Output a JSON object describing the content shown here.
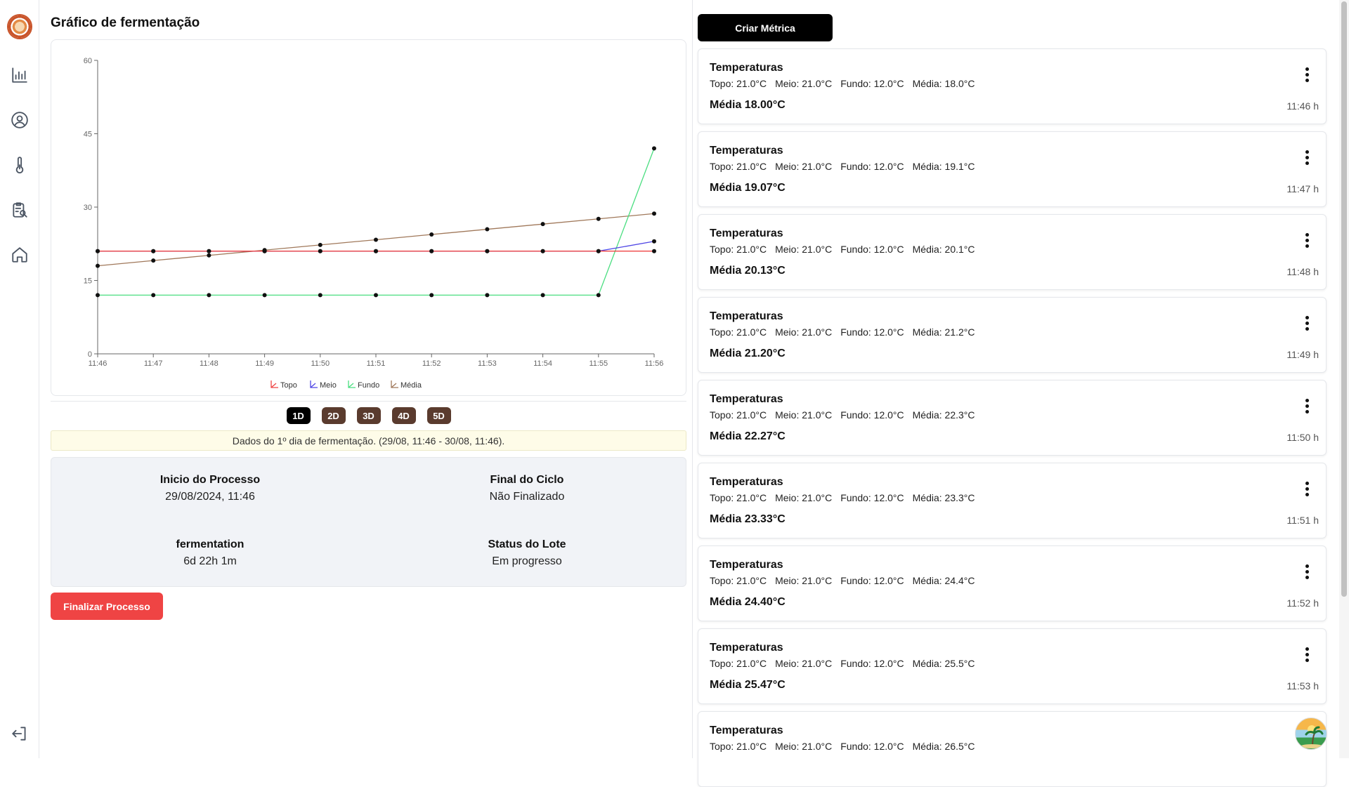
{
  "app": {
    "page_title": "Gráfico de fermentação"
  },
  "sidebar": {
    "items": [
      {
        "icon": "bar-chart-icon"
      },
      {
        "icon": "user-circle-icon"
      },
      {
        "icon": "thermometer-icon"
      },
      {
        "icon": "clipboard-search-icon"
      },
      {
        "icon": "home-icon"
      }
    ],
    "logout_icon": "logout-icon"
  },
  "chart_data": {
    "type": "line",
    "x": [
      "11:46",
      "11:47",
      "11:48",
      "11:49",
      "11:50",
      "11:51",
      "11:52",
      "11:53",
      "11:54",
      "11:55",
      "11:56"
    ],
    "yticks": [
      "0",
      "15",
      "30",
      "45",
      "60"
    ],
    "ylim": [
      0,
      60
    ],
    "series": [
      {
        "name": "Topo",
        "color": "#ef4444",
        "values": [
          21,
          21,
          21,
          21,
          21,
          21,
          21,
          21,
          21,
          21,
          21
        ]
      },
      {
        "name": "Meio",
        "color": "#4f46e5",
        "values": [
          21,
          21,
          21,
          21,
          21,
          21,
          21,
          21,
          21,
          21,
          23
        ]
      },
      {
        "name": "Fundo",
        "color": "#4ade80",
        "values": [
          12,
          12,
          12,
          12,
          12,
          12,
          12,
          12,
          12,
          12,
          42
        ]
      },
      {
        "name": "Média",
        "color": "#a0785a",
        "values": [
          18,
          19.07,
          20.13,
          21.2,
          22.27,
          23.33,
          24.4,
          25.47,
          26.53,
          27.6,
          28.67
        ]
      }
    ],
    "legend": "bottom-center",
    "grid": false
  },
  "day_tabs": [
    "1D",
    "2D",
    "3D",
    "4D",
    "5D"
  ],
  "active_day": "1D",
  "info_banner": "Dados do 1º dia de fermentação. (29/08, 11:46 - 30/08, 11:46).",
  "process": {
    "start_label": "Inicio do Processo",
    "start_value": "29/08/2024, 11:46",
    "end_label": "Final do Ciclo",
    "end_value": "Não Finalizado",
    "ferm_label": "fermentation",
    "ferm_value": "6d 22h 1m",
    "status_label": "Status do Lote",
    "status_value": "Em progresso"
  },
  "finish_button": "Finalizar Processo",
  "create_button": "Criar Métrica",
  "metrics": [
    {
      "title": "Temperaturas",
      "topo": "Topo: 21.0°C",
      "meio": "Meio: 21.0°C",
      "fundo": "Fundo: 12.0°C",
      "media": "Média: 18.0°C",
      "media_big": "Média 18.00°C",
      "time": "11:46 h"
    },
    {
      "title": "Temperaturas",
      "topo": "Topo: 21.0°C",
      "meio": "Meio: 21.0°C",
      "fundo": "Fundo: 12.0°C",
      "media": "Média: 19.1°C",
      "media_big": "Média 19.07°C",
      "time": "11:47 h"
    },
    {
      "title": "Temperaturas",
      "topo": "Topo: 21.0°C",
      "meio": "Meio: 21.0°C",
      "fundo": "Fundo: 12.0°C",
      "media": "Média: 20.1°C",
      "media_big": "Média 20.13°C",
      "time": "11:48 h"
    },
    {
      "title": "Temperaturas",
      "topo": "Topo: 21.0°C",
      "meio": "Meio: 21.0°C",
      "fundo": "Fundo: 12.0°C",
      "media": "Média: 21.2°C",
      "media_big": "Média 21.20°C",
      "time": "11:49 h"
    },
    {
      "title": "Temperaturas",
      "topo": "Topo: 21.0°C",
      "meio": "Meio: 21.0°C",
      "fundo": "Fundo: 12.0°C",
      "media": "Média: 22.3°C",
      "media_big": "Média 22.27°C",
      "time": "11:50 h"
    },
    {
      "title": "Temperaturas",
      "topo": "Topo: 21.0°C",
      "meio": "Meio: 21.0°C",
      "fundo": "Fundo: 12.0°C",
      "media": "Média: 23.3°C",
      "media_big": "Média 23.33°C",
      "time": "11:51 h"
    },
    {
      "title": "Temperaturas",
      "topo": "Topo: 21.0°C",
      "meio": "Meio: 21.0°C",
      "fundo": "Fundo: 12.0°C",
      "media": "Média: 24.4°C",
      "media_big": "Média 24.40°C",
      "time": "11:52 h"
    },
    {
      "title": "Temperaturas",
      "topo": "Topo: 21.0°C",
      "meio": "Meio: 21.0°C",
      "fundo": "Fundo: 12.0°C",
      "media": "Média: 25.5°C",
      "media_big": "Média 25.47°C",
      "time": "11:53 h"
    },
    {
      "title": "Temperaturas",
      "topo": "Topo: 21.0°C",
      "meio": "Meio: 21.0°C",
      "fundo": "Fundo: 12.0°C",
      "media": "Média: 26.5°C",
      "media_big": "",
      "time": ""
    }
  ]
}
